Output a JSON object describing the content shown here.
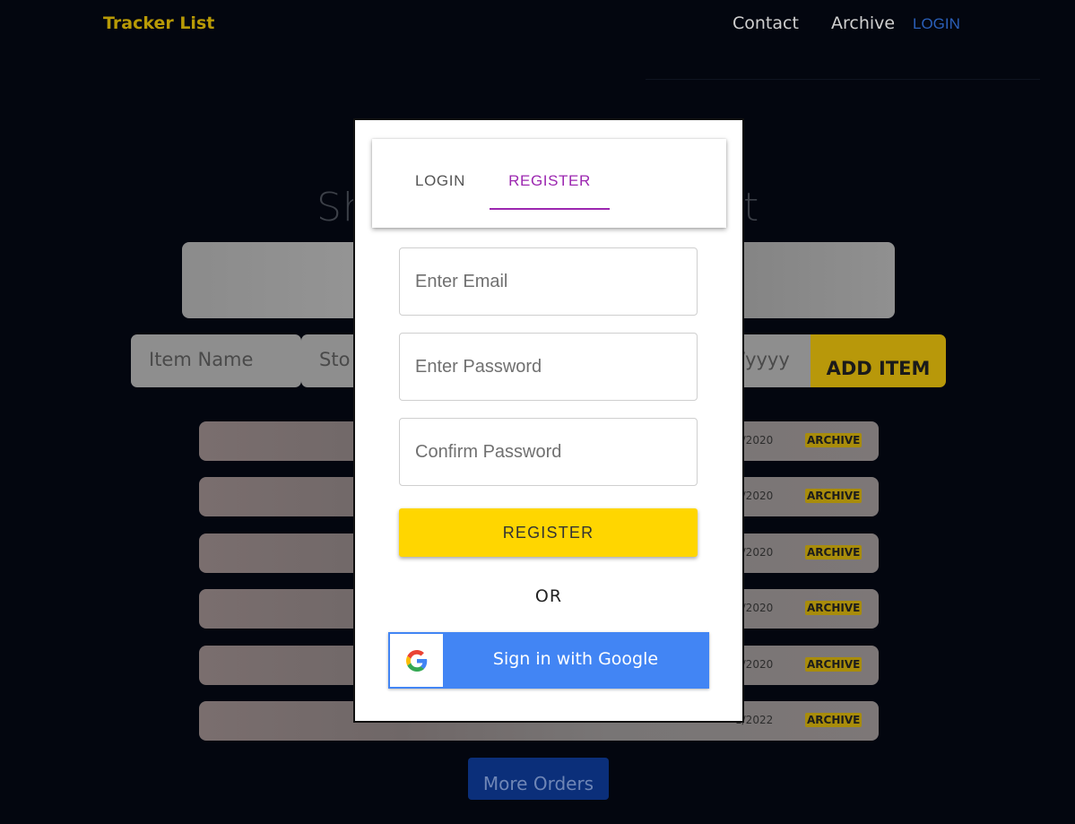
{
  "header": {
    "brand": "Tracker List",
    "nav": {
      "contact": "Contact",
      "archive": "Archive",
      "login": "LOGIN"
    }
  },
  "background": {
    "title_visible_left": "Sh",
    "title_visible_right": "t",
    "form": {
      "item_name_placeholder": "Item Name",
      "store_placeholder_visible": "Sto",
      "date_placeholder_visible": "/yyyy",
      "add_button": "ADD ITEM"
    },
    "rows": [
      {
        "date_visible": "0/2020",
        "archive_label": "ARCHIVE"
      },
      {
        "date_visible": "0/2020",
        "archive_label": "ARCHIVE"
      },
      {
        "date_visible": "0/2020",
        "archive_label": "ARCHIVE"
      },
      {
        "date_visible": "0/2020",
        "archive_label": "ARCHIVE"
      },
      {
        "date_visible": "0/2020",
        "archive_label": "ARCHIVE"
      },
      {
        "date_visible": "1/2022",
        "archive_label": "ARCHIVE"
      }
    ],
    "more_orders": "More Orders"
  },
  "modal": {
    "tabs": {
      "login": "LOGIN",
      "register": "REGISTER",
      "active": "register"
    },
    "fields": {
      "email_placeholder": "Enter Email",
      "password_placeholder": "Enter Password",
      "confirm_placeholder": "Confirm Password"
    },
    "register_button": "REGISTER",
    "or_text": "OR",
    "google_button": "Sign in with Google"
  },
  "colors": {
    "accent": "#ffd600",
    "tab_active": "#9c27b0",
    "google_blue": "#4285f4",
    "brand": "#b89a06"
  }
}
